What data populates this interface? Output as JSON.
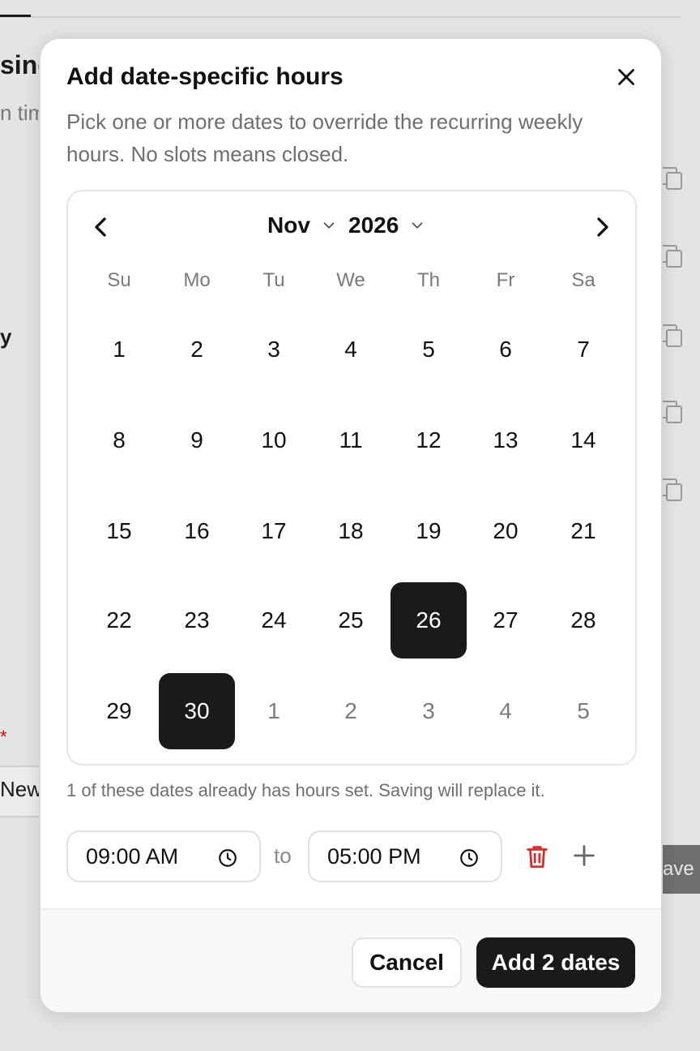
{
  "background": {
    "title_fragment": "sine",
    "subtitle_fragment": "n tim",
    "label_fragment": "y",
    "required_marker": "*",
    "new_fragment": "New",
    "save_fragment": "ave"
  },
  "modal": {
    "title": "Add date-specific hours",
    "description": "Pick one or more dates to override the recurring weekly hours. No slots means closed.",
    "close_icon": "close-icon"
  },
  "calendar": {
    "month": "Nov",
    "year": "2026",
    "weekdays": [
      "Su",
      "Mo",
      "Tu",
      "We",
      "Th",
      "Fr",
      "Sa"
    ],
    "weeks": [
      [
        {
          "d": "1"
        },
        {
          "d": "2"
        },
        {
          "d": "3"
        },
        {
          "d": "4"
        },
        {
          "d": "5"
        },
        {
          "d": "6"
        },
        {
          "d": "7"
        }
      ],
      [
        {
          "d": "8"
        },
        {
          "d": "9"
        },
        {
          "d": "10"
        },
        {
          "d": "11"
        },
        {
          "d": "12"
        },
        {
          "d": "13"
        },
        {
          "d": "14"
        }
      ],
      [
        {
          "d": "15"
        },
        {
          "d": "16"
        },
        {
          "d": "17"
        },
        {
          "d": "18"
        },
        {
          "d": "19"
        },
        {
          "d": "20"
        },
        {
          "d": "21"
        }
      ],
      [
        {
          "d": "22"
        },
        {
          "d": "23"
        },
        {
          "d": "24"
        },
        {
          "d": "25"
        },
        {
          "d": "26",
          "selected": true
        },
        {
          "d": "27"
        },
        {
          "d": "28"
        }
      ],
      [
        {
          "d": "29"
        },
        {
          "d": "30",
          "selected": true
        },
        {
          "d": "1",
          "outside": true
        },
        {
          "d": "2",
          "outside": true
        },
        {
          "d": "3",
          "outside": true
        },
        {
          "d": "4",
          "outside": true
        },
        {
          "d": "5",
          "outside": true
        }
      ]
    ]
  },
  "warning": "1 of these dates already has hours set. Saving will replace it.",
  "slot": {
    "start": "09:00 AM",
    "separator": "to",
    "end": "05:00 PM"
  },
  "footer": {
    "cancel_label": "Cancel",
    "add_label": "Add 2 dates"
  },
  "colors": {
    "accent": "#1a1a1a",
    "danger": "#d32f2f",
    "muted_text": "#6f6f6f"
  }
}
